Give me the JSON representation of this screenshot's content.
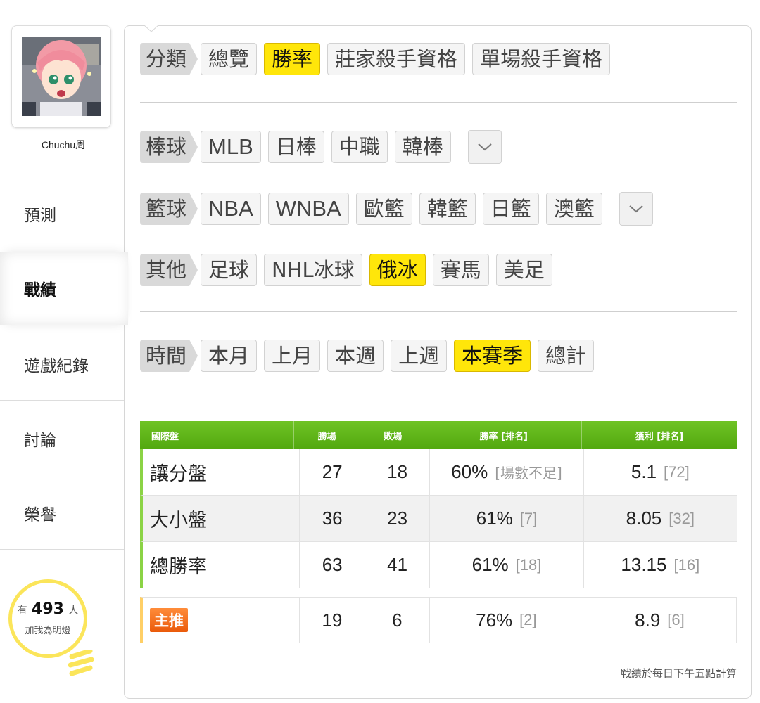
{
  "user": {
    "name": "Chuchu周"
  },
  "sidebar": {
    "items": [
      {
        "label": "預測",
        "active": false
      },
      {
        "label": "戰績",
        "active": true
      },
      {
        "label": "遊戲紀錄",
        "active": false
      },
      {
        "label": "討論",
        "active": false
      },
      {
        "label": "榮譽",
        "active": false
      }
    ],
    "fans": {
      "prefix": "有",
      "count": "493",
      "suffix": "人",
      "caption": "加我為明燈"
    }
  },
  "filters": {
    "category": {
      "label": "分類",
      "options": [
        "總覽",
        "勝率",
        "莊家殺手資格",
        "單場殺手資格"
      ],
      "selected": "勝率"
    },
    "baseball": {
      "label": "棒球",
      "options": [
        "MLB",
        "日棒",
        "中職",
        "韓棒"
      ]
    },
    "basketball": {
      "label": "籃球",
      "options": [
        "NBA",
        "WNBA",
        "歐籃",
        "韓籃",
        "日籃",
        "澳籃"
      ]
    },
    "other": {
      "label": "其他",
      "options": [
        "足球",
        "NHL冰球",
        "俄冰",
        "賽馬",
        "美足"
      ],
      "selected": "俄冰"
    },
    "time": {
      "label": "時間",
      "options": [
        "本月",
        "上月",
        "本週",
        "上週",
        "本賽季",
        "總計"
      ],
      "selected": "本賽季"
    }
  },
  "table": {
    "headers": [
      "國際盤",
      "勝場",
      "敗場",
      "勝率 [排名]",
      "獲利 [排名]"
    ],
    "rows": [
      {
        "name": "讓分盤",
        "wins": "27",
        "losses": "18",
        "rate": "60%",
        "rate_rank": "[場數不足]",
        "profit": "5.1",
        "profit_rank": "[72]"
      },
      {
        "name": "大小盤",
        "wins": "36",
        "losses": "23",
        "rate": "61%",
        "rate_rank": "[7]",
        "profit": "8.05",
        "profit_rank": "[32]"
      },
      {
        "name": "總勝率",
        "wins": "63",
        "losses": "41",
        "rate": "61%",
        "rate_rank": "[18]",
        "profit": "13.15",
        "profit_rank": "[16]"
      }
    ],
    "featured": {
      "badge": "主推",
      "wins": "19",
      "losses": "6",
      "rate": "76%",
      "rate_rank": "[2]",
      "profit": "8.9",
      "profit_rank": "[6]"
    }
  },
  "footnote": "戰績於每日下午五點計算",
  "colors": {
    "selected": "#ffe60a",
    "header_green": "#5cb31a",
    "badge_orange": "#f06a14",
    "bulb_yellow": "#fbe55a"
  }
}
